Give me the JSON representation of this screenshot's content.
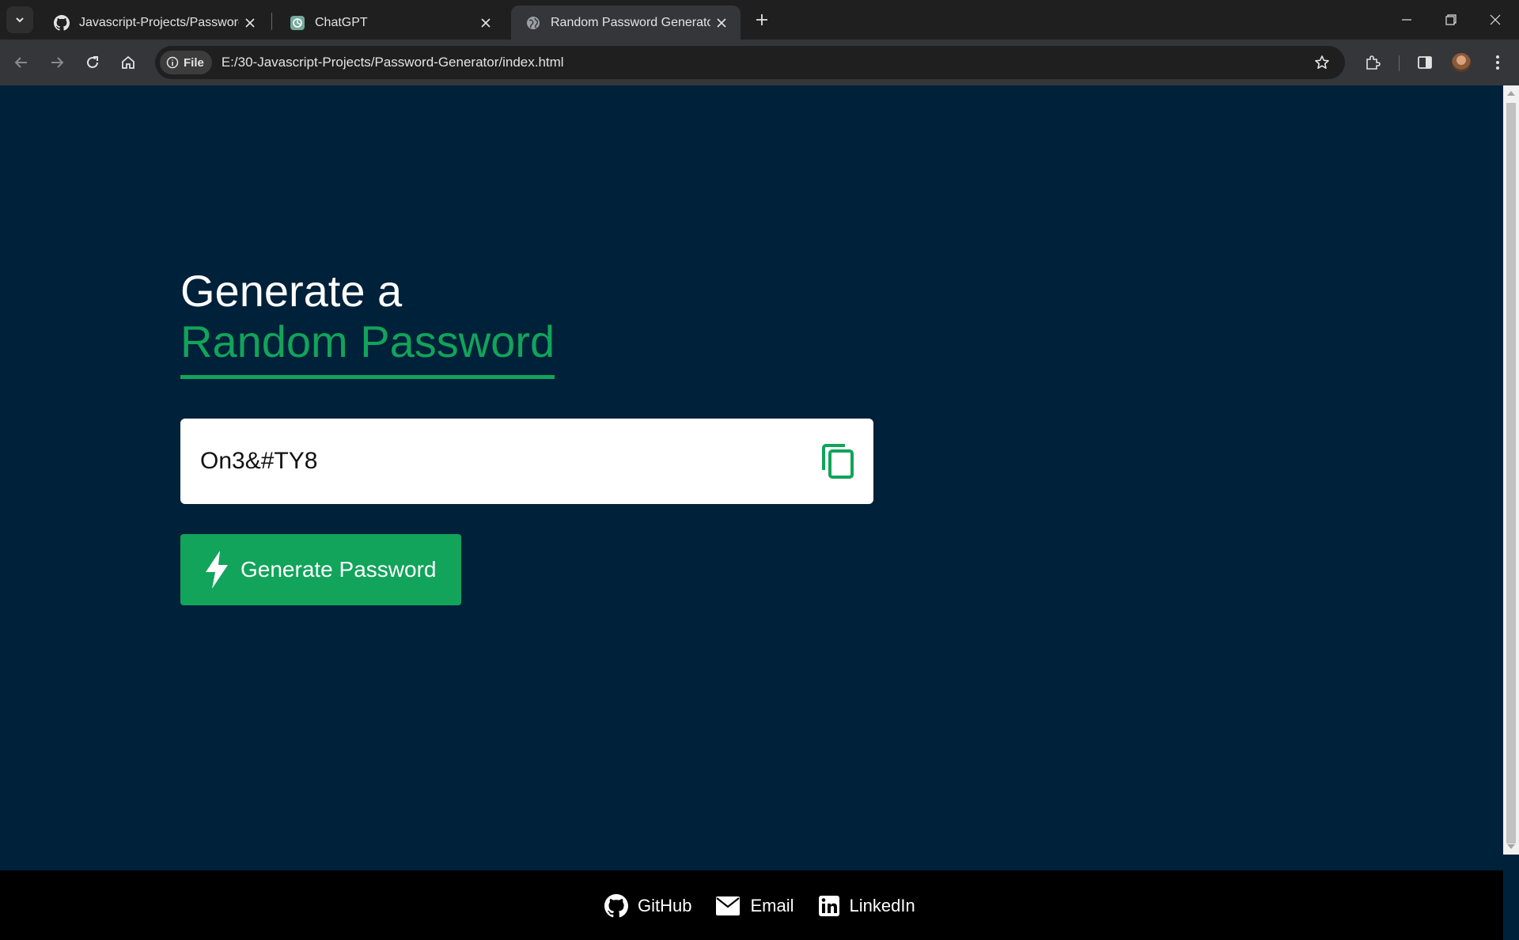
{
  "browser": {
    "tabs": [
      {
        "title": "Javascript-Projects/Password-Ge",
        "icon": "github-icon",
        "active": false
      },
      {
        "title": "ChatGPT",
        "icon": "chatgpt-icon",
        "active": false
      },
      {
        "title": "Random Password Generator",
        "icon": "globe-icon",
        "active": true
      }
    ],
    "site_info_chip": "File",
    "url": "E:/30-Javascript-Projects/Password-Generator/index.html"
  },
  "page": {
    "heading_line1": "Generate a",
    "heading_line2": "Random Password",
    "password_value": "On3&#TY8",
    "generate_button_label": "Generate Password",
    "footer_links": [
      {
        "label": "GitHub",
        "icon": "github-icon"
      },
      {
        "label": "Email",
        "icon": "envelope-icon"
      },
      {
        "label": "LinkedIn",
        "icon": "linkedin-icon"
      }
    ]
  },
  "colors": {
    "page_background": "#00213a",
    "accent_green": "#11a45a",
    "footer_background": "#000000",
    "browser_chrome": "#1f1f1f"
  }
}
